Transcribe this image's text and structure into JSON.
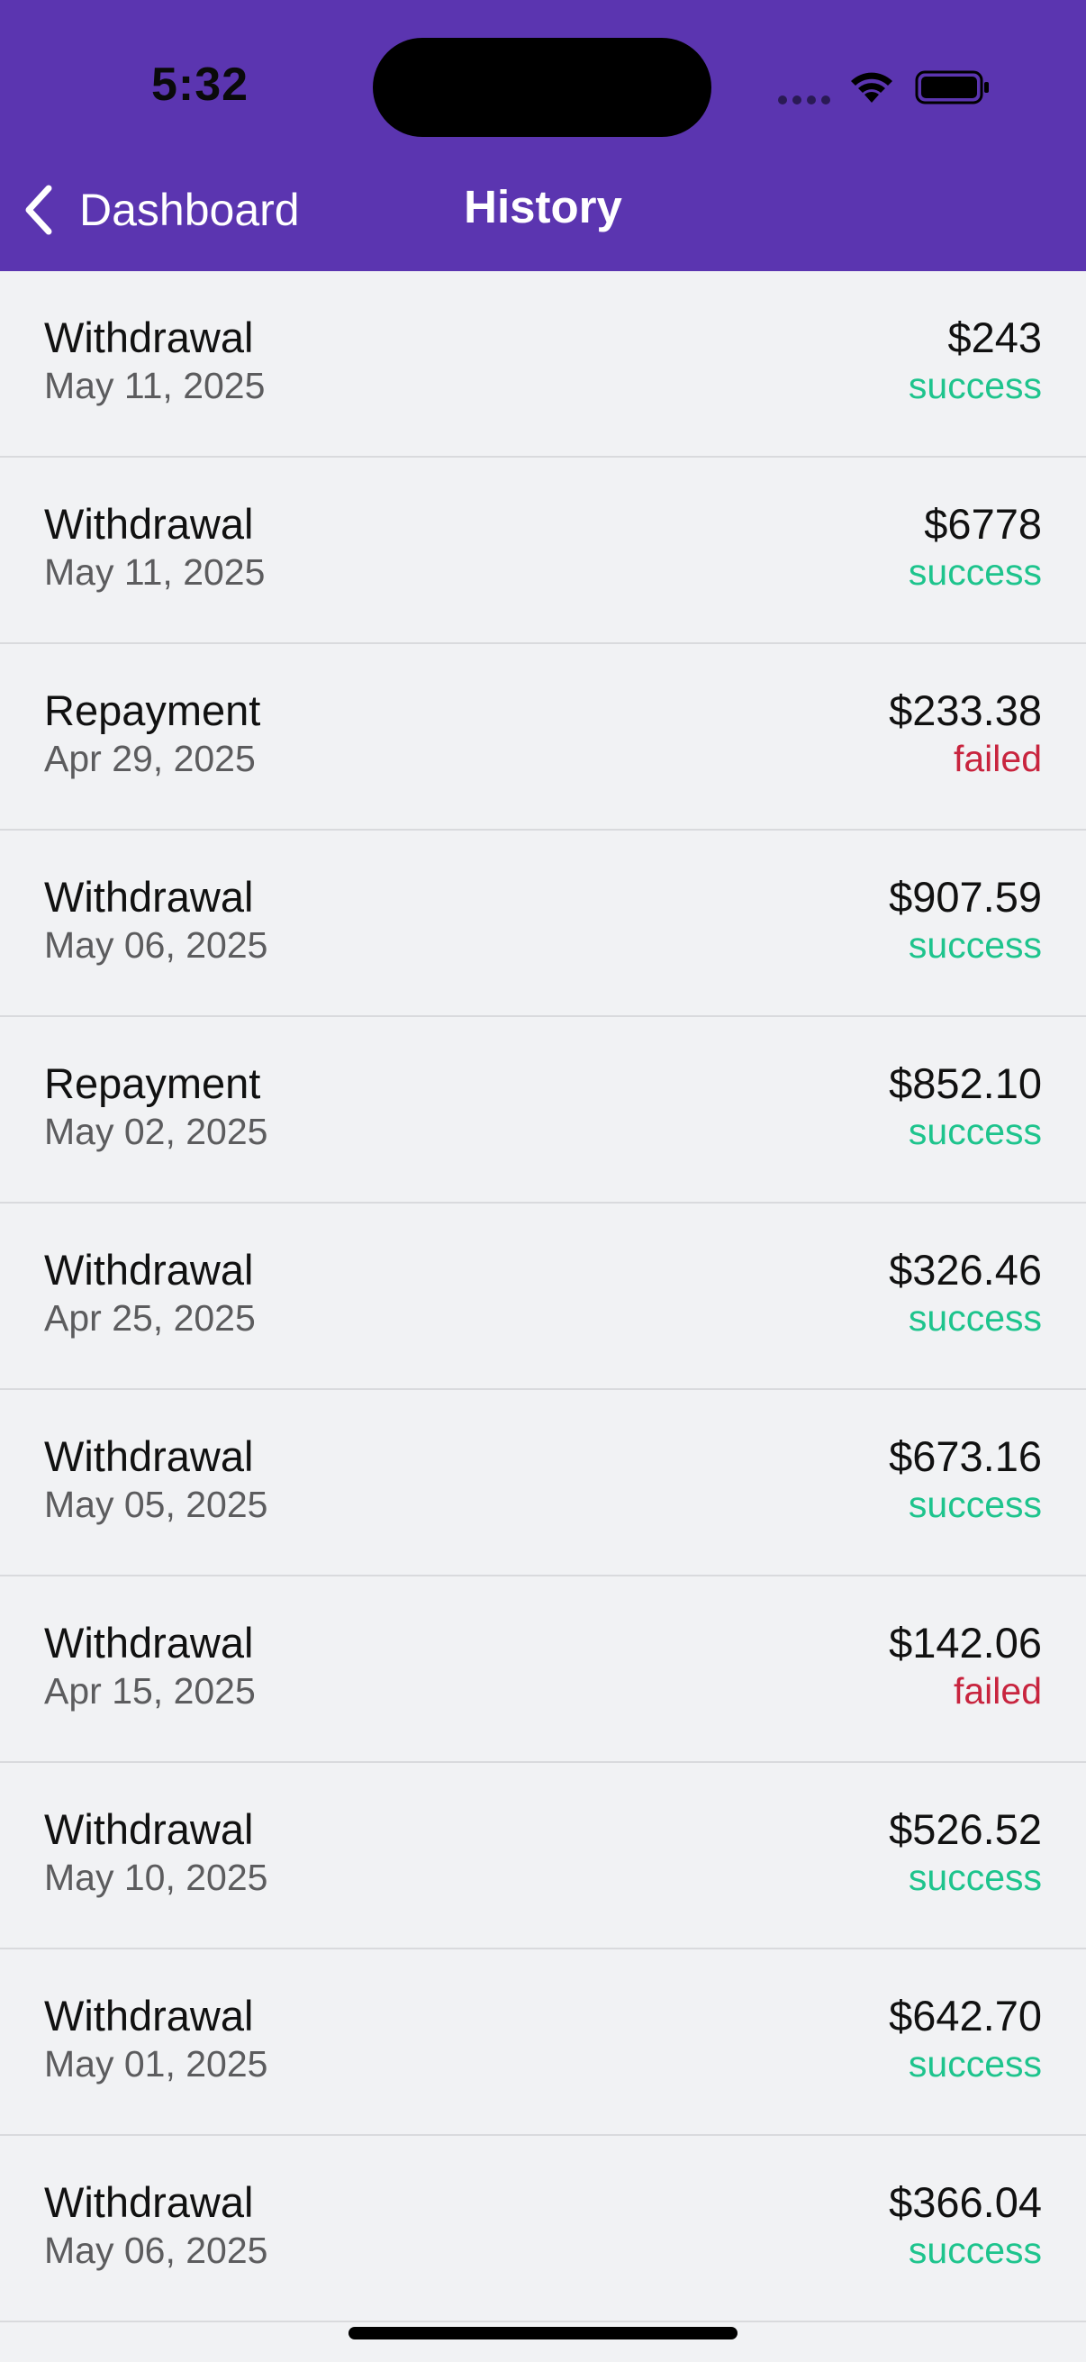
{
  "status_bar": {
    "time": "5:32"
  },
  "nav": {
    "back_label": "Dashboard",
    "title": "History"
  },
  "colors": {
    "header": "#5b35b0",
    "success": "#1ec48d",
    "failed": "#c8243e"
  },
  "transactions": [
    {
      "type": "Withdrawal",
      "date": "May 11, 2025",
      "amount": "$243",
      "status": "success"
    },
    {
      "type": "Withdrawal",
      "date": "May 11, 2025",
      "amount": "$6778",
      "status": "success"
    },
    {
      "type": "Repayment",
      "date": "Apr 29, 2025",
      "amount": "$233.38",
      "status": "failed"
    },
    {
      "type": "Withdrawal",
      "date": "May 06, 2025",
      "amount": "$907.59",
      "status": "success"
    },
    {
      "type": "Repayment",
      "date": "May 02, 2025",
      "amount": "$852.10",
      "status": "success"
    },
    {
      "type": "Withdrawal",
      "date": "Apr 25, 2025",
      "amount": "$326.46",
      "status": "success"
    },
    {
      "type": "Withdrawal",
      "date": "May 05, 2025",
      "amount": "$673.16",
      "status": "success"
    },
    {
      "type": "Withdrawal",
      "date": "Apr 15, 2025",
      "amount": "$142.06",
      "status": "failed"
    },
    {
      "type": "Withdrawal",
      "date": "May 10, 2025",
      "amount": "$526.52",
      "status": "success"
    },
    {
      "type": "Withdrawal",
      "date": "May 01, 2025",
      "amount": "$642.70",
      "status": "success"
    },
    {
      "type": "Withdrawal",
      "date": "May 06, 2025",
      "amount": "$366.04",
      "status": "success"
    }
  ]
}
